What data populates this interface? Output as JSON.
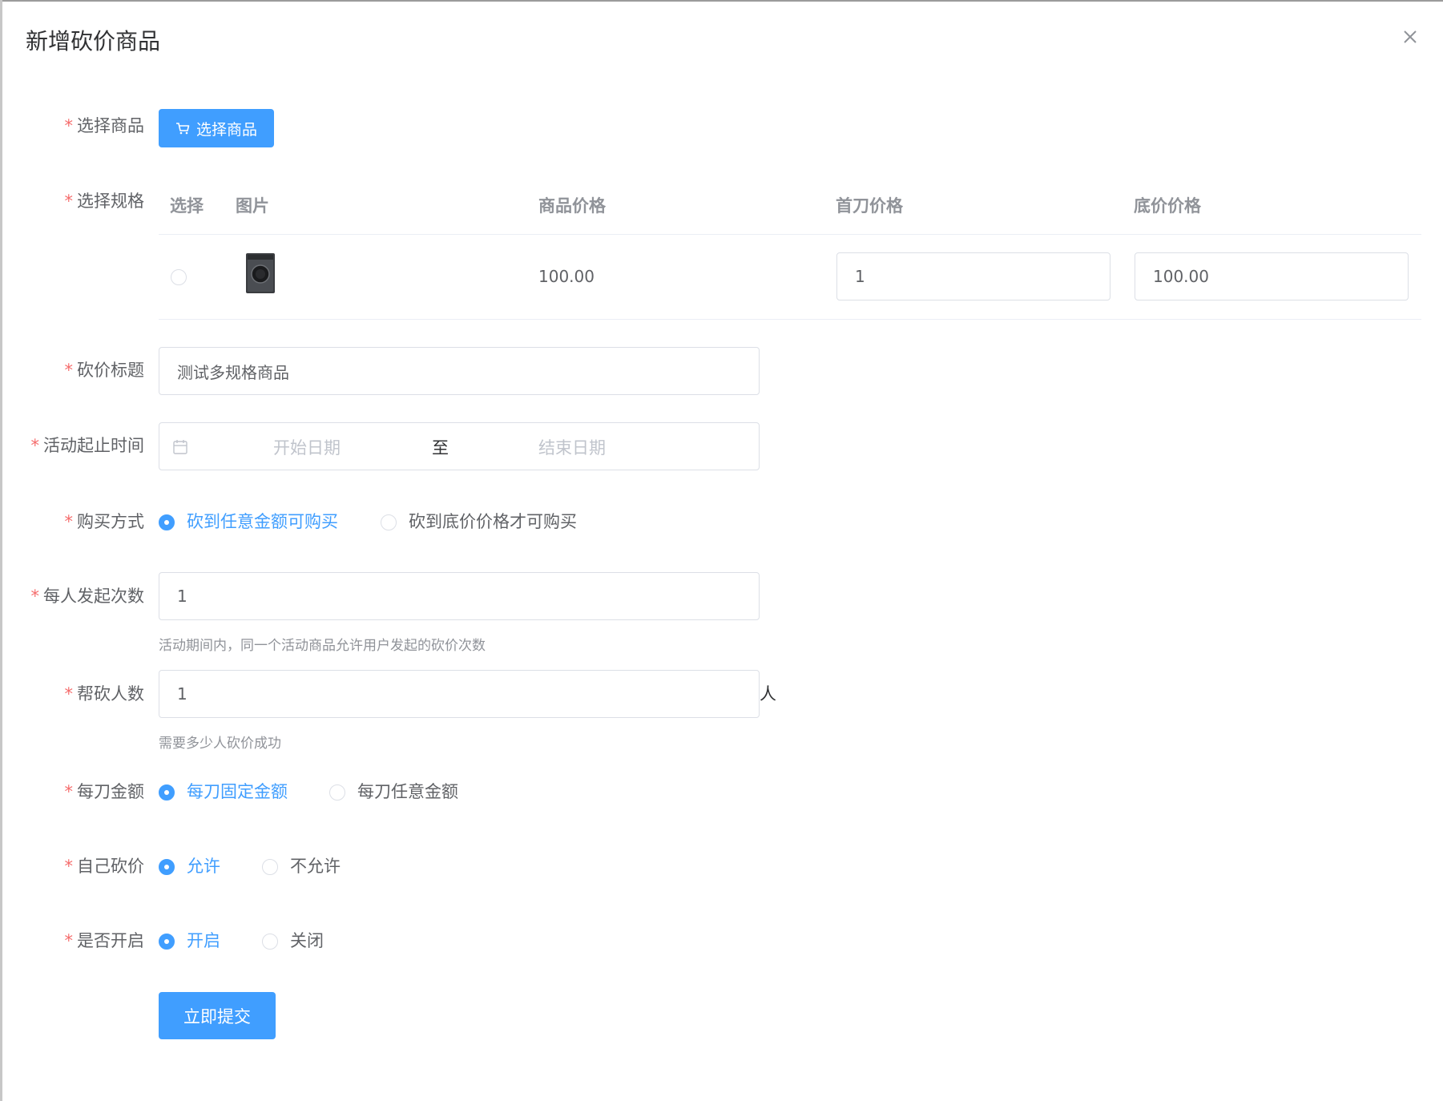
{
  "dialog": {
    "title": "新增砍价商品"
  },
  "form": {
    "required_mark": "*",
    "select_product": {
      "label": "选择商品",
      "button_label": "选择商品",
      "button_icon": "cart-icon"
    },
    "select_spec": {
      "label": "选择规格",
      "columns": [
        "选择",
        "图片",
        "商品价格",
        "首刀价格",
        "底价价格"
      ],
      "rows": [
        {
          "selected": false,
          "image": "washing-machine",
          "price": "100.00",
          "first_cut_price": "1",
          "floor_price": "100.00"
        }
      ]
    },
    "bargain_title": {
      "label": "砍价标题",
      "value": "测试多规格商品"
    },
    "activity_time": {
      "label": "活动起止时间",
      "start_placeholder": "开始日期",
      "separator": "至",
      "end_placeholder": "结束日期",
      "icon": "calendar-icon"
    },
    "purchase_mode": {
      "label": "购买方式",
      "options": [
        "砍到任意金额可购买",
        "砍到底价价格才可购买"
      ],
      "selected": 0
    },
    "launch_times": {
      "label": "每人发起次数",
      "value": "1",
      "hint": "活动期间内，同一个活动商品允许用户发起的砍价次数"
    },
    "helper_count": {
      "label": "帮砍人数",
      "value": "1",
      "suffix": "人",
      "hint": "需要多少人砍价成功"
    },
    "cut_amount": {
      "label": "每刀金额",
      "options": [
        "每刀固定金额",
        "每刀任意金额"
      ],
      "selected": 0
    },
    "self_cut": {
      "label": "自己砍价",
      "options": [
        "允许",
        "不允许"
      ],
      "selected": 0
    },
    "enabled": {
      "label": "是否开启",
      "options": [
        "开启",
        "关闭"
      ],
      "selected": 0
    },
    "submit_label": "立即提交"
  },
  "colors": {
    "primary": "#409eff",
    "required": "#f56c6c",
    "border": "#dcdfe6",
    "text": "#606266",
    "hint": "#909399"
  }
}
